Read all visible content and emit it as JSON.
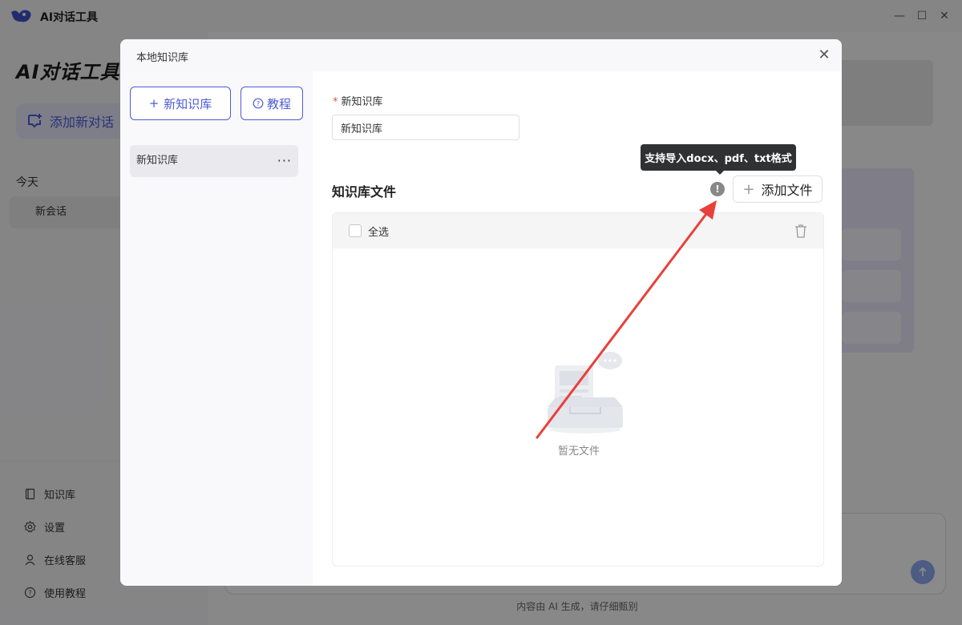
{
  "app": {
    "title": "AI对话工具",
    "brand": "AI对话工具",
    "new_chat_label": "添加新对话",
    "section_today": "今天",
    "session_label": "新会话",
    "menu": [
      {
        "label": "知识库",
        "icon": "book-icon"
      },
      {
        "label": "设置",
        "icon": "gear-icon"
      },
      {
        "label": "在线客服",
        "icon": "user-icon"
      },
      {
        "label": "使用教程",
        "icon": "help-circle-icon"
      }
    ],
    "footer_note": "内容由 AI 生成，请仔细甄别"
  },
  "window_controls": {
    "minimize": "—",
    "maximize": "☐",
    "close": "✕"
  },
  "modal": {
    "title": "本地知识库",
    "close_glyph": "✕",
    "new_kb_button": "新知识库",
    "tutorial_button": "教程",
    "kb_list": [
      {
        "name": "新知识库",
        "more": "···"
      }
    ],
    "name_field": {
      "label": "新知识库",
      "value": "新知识库",
      "required_mark": "*"
    },
    "files_section_title": "知识库文件",
    "tooltip": "支持导入docx、pdf、txt格式",
    "info_glyph": "!",
    "add_file_button": "添加文件",
    "select_all_label": "全选",
    "empty_text": "暂无文件"
  },
  "colors": {
    "accent": "#4b5bd6",
    "arrow": "#e8403a",
    "tooltip_bg": "#303133"
  }
}
